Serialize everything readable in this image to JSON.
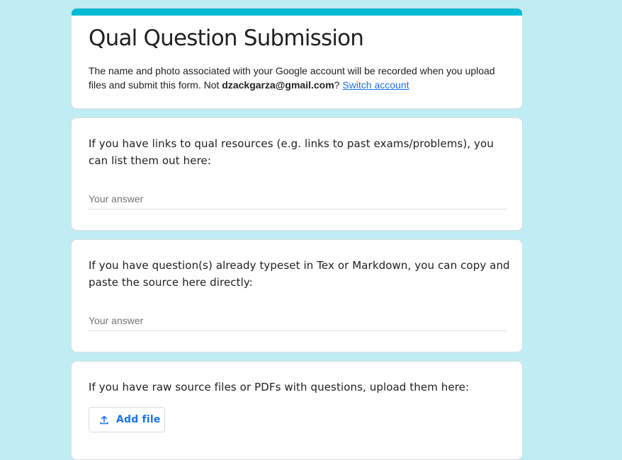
{
  "form": {
    "title": "Qual Question Submission",
    "notice_prefix": "The name and photo associated with your Google account will be recorded when you upload files and submit this form. Not ",
    "email": "dzackgarza@gmail.com",
    "notice_suffix": "? ",
    "switch_account_label": "Switch account",
    "accent_color": "#00bcd4",
    "background_color": "#bfedf3"
  },
  "questions": [
    {
      "title": "If you have links to qual resources (e.g. links to past exams/problems), you can list them out here:",
      "placeholder": "Your answer",
      "value": ""
    },
    {
      "title": "If you have question(s) already typeset in Tex or Markdown, you can copy and paste the source here directly:",
      "placeholder": "Your answer",
      "value": ""
    },
    {
      "title": "If you have raw source files or PDFs with questions, upload them here:",
      "add_file_label": "Add file",
      "add_file_icon": "upload-icon"
    }
  ]
}
